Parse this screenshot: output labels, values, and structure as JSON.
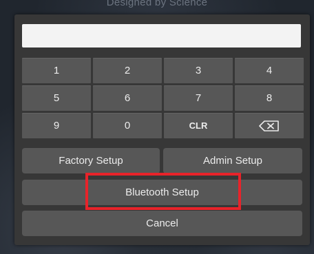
{
  "background": {
    "tagline": "Designed by Science"
  },
  "dialog": {
    "pin_value": "",
    "keypad": [
      "1",
      "2",
      "3",
      "4",
      "5",
      "6",
      "7",
      "8",
      "9",
      "0",
      "CLR"
    ],
    "backspace_icon": "backspace-icon",
    "factory_setup_label": "Factory Setup",
    "admin_setup_label": "Admin Setup",
    "bluetooth_setup_label": "Bluetooth Setup",
    "cancel_label": "Cancel"
  },
  "colors": {
    "highlight": "#e8232a",
    "button": "#575757",
    "dialog": "#373737"
  }
}
